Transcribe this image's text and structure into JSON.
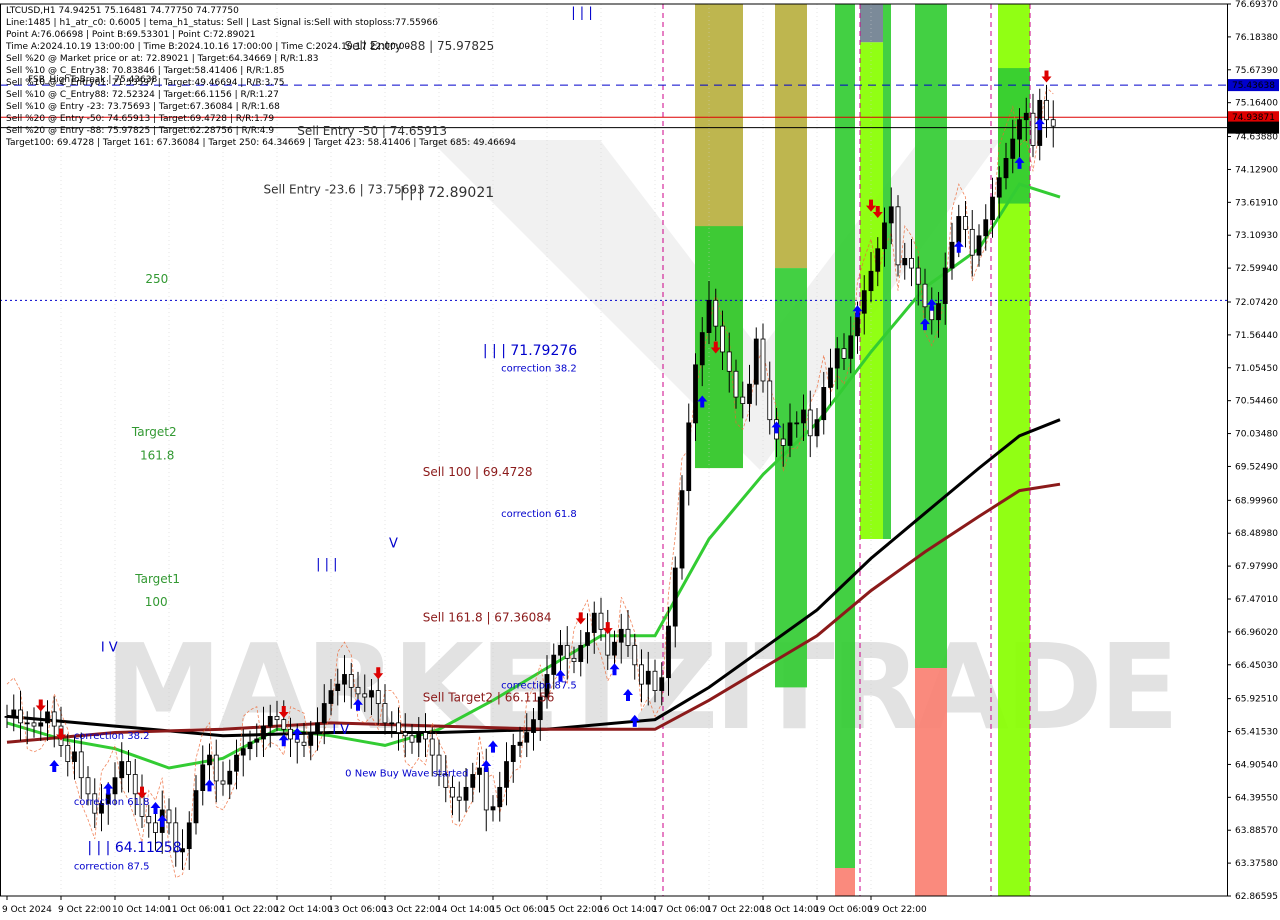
{
  "header": {
    "lines": [
      "LTCUSD,H1  74.94251 75.16481 74.77750 74.77750",
      "Line:1485  | h1_atr_c0: 0.6005  | tema_h1_status: Sell  | Last Signal is:Sell with stoploss:77.55966",
      "Point A:76.06698  | Point B:69.53301  | Point C:72.89021",
      "Time A:2024.10.19 13:00:00  | Time B:2024.10.16 17:00:00  | Time C:2024.10.17 22:00:00",
      "Sell %20 @ Market price or at: 72.89021  | Target:64.34669  | R/R:1.83",
      "Sell %10 @ C_Entry38: 70.83846  | Target:58.41406  | R/R:1.85",
      "Sell %10 @ C_Entry61: 71.53597  | Target:49.46694  | R/R:3.75",
      "Sell %10 @ C_Entry88: 72.52324  | Target:66.1156  | R/R:1.27",
      "Sell %10 @ Entry -23: 73.75693  | Target:67.36084  | R/R:1.68",
      "Sell %20 @ Entry -50: 74.65913  | Target:69.4728  | R/R:1.79",
      "Sell %20 @ Entry -88: 75.97825  | Target:62.28756  | R/R:4.9",
      "Target100: 69.4728  | Target 161: 67.36084  | Target 250: 64.34669  | Target 423: 58.41406  | Target 685: 49.46694"
    ],
    "overlay_label": "FSB_HighToBreak | 75.43638"
  },
  "colors": {
    "background": "#ffffff",
    "bull_candle": "#000000",
    "green_ma": "#33cc33",
    "black_ma": "#000000",
    "red_ma": "#8b1a1a",
    "buy_arrow": "#0000ff",
    "sell_arrow": "#dd0000",
    "zone_green": "#33cc33",
    "zone_lime": "#88ff00",
    "zone_olive": "#b8b040",
    "zone_salmon": "#fa8072",
    "zone_slate": "#708090",
    "price_line_red": "#dd0000",
    "price_line_blue": "#0000cc",
    "vline_magenta": "#cc0088",
    "ann_green": "#339933",
    "ann_blue": "#0000cc",
    "ann_darkred": "#8b1a1a",
    "ann_darkgray": "#333333",
    "watermark": "#dddddd"
  },
  "watermark": {
    "text": "MARKETZITRADE"
  },
  "price_tags": [
    {
      "label": "75.43638",
      "value": 75.43638,
      "bg": "#0000cc",
      "fg": "#ffffff",
      "style": "dashed"
    },
    {
      "label": "74.93871",
      "value": 74.93871,
      "bg": "#dd0000",
      "fg": "#ffffff",
      "style": "solid"
    },
    {
      "label": "74.77750",
      "value": 74.7775,
      "bg": "#000000",
      "fg": "#ffffff",
      "style": "solid"
    }
  ],
  "hlines": [
    {
      "value": 72.1,
      "color": "#0000cc",
      "style": "dotted"
    }
  ],
  "annotations": [
    {
      "text": "Sell Entry -88 | 75.97825",
      "color": "#333333",
      "size": 12,
      "x": 50,
      "y": 75.97825
    },
    {
      "text": "Sell Entry -50 | 74.65913",
      "color": "#333333",
      "size": 12,
      "x": 43,
      "y": 74.65913
    },
    {
      "text": "Sell Entry -23.6 | 73.75693",
      "color": "#333333",
      "size": 12,
      "x": 38,
      "y": 73.75693
    },
    {
      "text": "| | | 72.89021",
      "color": "#333333",
      "size": 14,
      "x": 58.2,
      "y": 73.7
    },
    {
      "text": "250",
      "color": "#339933",
      "size": 12,
      "x": 20.5,
      "y": 72.37
    },
    {
      "text": "| | | 71.79276",
      "color": "#0000cc",
      "size": 14,
      "x": 70.5,
      "y": 71.25
    },
    {
      "text": "correction 38.2",
      "color": "#0000cc",
      "size": 10,
      "x": 73.2,
      "y": 71.0
    },
    {
      "text": "Target2",
      "color": "#339933",
      "size": 12,
      "x": 18.5,
      "y": 70.0
    },
    {
      "text": "161.8",
      "color": "#339933",
      "size": 12,
      "x": 19.7,
      "y": 69.63
    },
    {
      "text": "Sell 100 | 69.4728",
      "color": "#8b1a1a",
      "size": 12,
      "x": 61.6,
      "y": 69.38
    },
    {
      "text": "correction 61.8",
      "color": "#0000cc",
      "size": 10,
      "x": 73.2,
      "y": 68.74
    },
    {
      "text": "| | |",
      "color": "#0000cc",
      "size": 13,
      "x": 45.8,
      "y": 67.95
    },
    {
      "text": "V",
      "color": "#0000cc",
      "size": 13,
      "x": 56.6,
      "y": 68.27
    },
    {
      "text": "Target1",
      "color": "#339933",
      "size": 12,
      "x": 19.0,
      "y": 67.72
    },
    {
      "text": "100",
      "color": "#339933",
      "size": 12,
      "x": 20.4,
      "y": 67.36
    },
    {
      "text": "Sell 161.8 | 67.36084",
      "color": "#8b1a1a",
      "size": 12,
      "x": 61.6,
      "y": 67.12
    },
    {
      "text": "I V",
      "color": "#0000cc",
      "size": 13,
      "x": 13.9,
      "y": 66.66
    },
    {
      "text": "correction 87.5",
      "color": "#0000cc",
      "size": 10,
      "x": 73.2,
      "y": 66.08
    },
    {
      "text": "Sell Target2 | 66.1156",
      "color": "#8b1a1a",
      "size": 12,
      "x": 61.6,
      "y": 65.88
    },
    {
      "text": "correction 38.2",
      "color": "#0000cc",
      "size": 10,
      "x": 9.9,
      "y": 65.3
    },
    {
      "text": "I V",
      "color": "#0000cc",
      "size": 13,
      "x": 48.2,
      "y": 65.38
    },
    {
      "text": "0 New Buy Wave started",
      "color": "#0000cc",
      "size": 10,
      "x": 50.1,
      "y": 64.72
    },
    {
      "text": "correction 61.8",
      "color": "#0000cc",
      "size": 10,
      "x": 9.9,
      "y": 64.28
    },
    {
      "text": "| | | 64.11258",
      "color": "#0000cc",
      "size": 14,
      "x": 11.9,
      "y": 63.55
    },
    {
      "text": "correction 87.5",
      "color": "#0000cc",
      "size": 10,
      "x": 9.9,
      "y": 63.28
    },
    {
      "text": "| | |",
      "color": "#0000cc",
      "size": 13,
      "x": 83.6,
      "y": 76.5
    }
  ],
  "chart_data": {
    "type": "candlestick",
    "symbol": "LTCUSD",
    "timeframe": "H1",
    "ohlc_last": {
      "open": 74.94251,
      "high": 75.16481,
      "low": 74.7775,
      "close": 74.7775
    },
    "ylim": [
      62.86595,
      76.6937
    ],
    "yticks": [
      76.6937,
      76.1838,
      75.6739,
      75.164,
      74.6388,
      74.129,
      73.6191,
      73.1093,
      72.5994,
      72.0742,
      71.5644,
      71.0545,
      70.5446,
      70.0348,
      69.5249,
      68.9996,
      68.4898,
      67.9799,
      67.4701,
      66.9602,
      66.4503,
      65.9251,
      65.4153,
      64.9054,
      64.3955,
      63.8857,
      63.3758,
      62.86595
    ],
    "ytick_labels": [
      "76.69370",
      "76.18380",
      "75.67390",
      "75.16400",
      "74.63880",
      "74.12900",
      "73.61910",
      "73.10930",
      "72.59940",
      "72.07420",
      "71.56440",
      "71.05450",
      "70.54460",
      "70.03480",
      "69.52490",
      "68.99960",
      "68.48980",
      "67.97990",
      "67.47010",
      "66.96020",
      "66.45030",
      "65.92510",
      "65.41530",
      "64.90540",
      "64.39550",
      "63.88570",
      "63.37580",
      "62.86595"
    ],
    "xticks": [
      0,
      8,
      16,
      24,
      32,
      40,
      48,
      56,
      64,
      72,
      80,
      88,
      96,
      104,
      112,
      120,
      128
    ],
    "xtick_labels": [
      "9 Oct 2024",
      "9 Oct 22:00",
      "10 Oct 14:00",
      "11 Oct 06:00",
      "11 Oct 22:00",
      "12 Oct 14:00",
      "13 Oct 06:00",
      "13 Oct 22:00",
      "14 Oct 14:00",
      "15 Oct 06:00",
      "15 Oct 22:00",
      "16 Oct 14:00",
      "17 Oct 06:00",
      "17 Oct 22:00",
      "18 Oct 14:00",
      "19 Oct 06:00",
      "19 Oct 22:00"
    ],
    "x_count": 156,
    "closes": [
      65.65,
      65.75,
      65.55,
      65.55,
      65.5,
      65.55,
      65.72,
      65.5,
      65.2,
      64.95,
      65.1,
      64.7,
      64.45,
      64.15,
      64.3,
      64.45,
      64.7,
      64.95,
      64.75,
      64.45,
      64.1,
      64.0,
      63.85,
      64.2,
      64.0,
      63.55,
      63.6,
      64.0,
      64.5,
      64.9,
      65.05,
      64.65,
      64.6,
      64.8,
      65.05,
      65.15,
      65.25,
      65.3,
      65.5,
      65.65,
      65.6,
      65.45,
      65.3,
      65.25,
      65.2,
      65.4,
      65.55,
      65.85,
      66.05,
      66.15,
      66.3,
      66.1,
      66.0,
      65.95,
      66.05,
      65.85,
      65.55,
      65.55,
      65.4,
      65.35,
      65.25,
      65.4,
      65.3,
      65.05,
      64.75,
      64.55,
      64.4,
      64.35,
      64.55,
      64.75,
      64.85,
      64.2,
      64.25,
      64.55,
      64.95,
      65.2,
      65.25,
      65.4,
      65.6,
      65.95,
      66.3,
      66.6,
      66.75,
      66.55,
      66.5,
      66.75,
      66.95,
      67.25,
      67.0,
      66.6,
      66.8,
      67.0,
      66.75,
      66.45,
      66.15,
      66.35,
      66.05,
      66.25,
      67.05,
      67.95,
      69.15,
      70.2,
      71.1,
      71.6,
      72.1,
      71.7,
      71.3,
      71.0,
      70.6,
      70.5,
      70.8,
      71.5,
      70.85,
      70.25,
      69.95,
      69.85,
      70.2,
      70.2,
      70.4,
      70.0,
      70.25,
      70.75,
      71.05,
      71.35,
      71.2,
      71.55,
      71.9,
      72.25,
      72.55,
      72.9,
      73.3,
      73.55,
      72.65,
      72.75,
      72.6,
      72.35,
      72.0,
      71.8,
      72.05,
      72.6,
      73.0,
      73.4,
      73.2,
      72.8,
      73.1,
      73.35,
      73.7,
      74.0,
      74.3,
      74.6,
      74.9,
      75.0,
      74.5,
      75.2,
      74.9,
      74.8
    ],
    "series": [
      {
        "name": "",
        "color": "#33cc33",
        "points": [
          [
            0,
            65.55
          ],
          [
            8,
            65.3
          ],
          [
            16,
            65.15
          ],
          [
            24,
            64.85
          ],
          [
            32,
            65.0
          ],
          [
            40,
            65.45
          ],
          [
            48,
            65.35
          ],
          [
            56,
            65.2
          ],
          [
            64,
            65.45
          ],
          [
            72,
            65.9
          ],
          [
            80,
            66.4
          ],
          [
            88,
            66.9
          ],
          [
            96,
            66.9
          ],
          [
            104,
            68.4
          ],
          [
            112,
            69.4
          ],
          [
            120,
            70.2
          ],
          [
            128,
            71.3
          ],
          [
            136,
            72.3
          ],
          [
            144,
            72.9
          ],
          [
            150,
            73.9
          ],
          [
            156,
            73.7
          ]
        ]
      },
      {
        "name": "",
        "color": "#000000",
        "points": [
          [
            0,
            65.65
          ],
          [
            16,
            65.5
          ],
          [
            32,
            65.35
          ],
          [
            48,
            65.4
          ],
          [
            64,
            65.4
          ],
          [
            80,
            65.45
          ],
          [
            96,
            65.6
          ],
          [
            104,
            66.1
          ],
          [
            112,
            66.7
          ],
          [
            120,
            67.3
          ],
          [
            128,
            68.1
          ],
          [
            136,
            68.8
          ],
          [
            144,
            69.5
          ],
          [
            150,
            70.0
          ],
          [
            156,
            70.25
          ]
        ]
      },
      {
        "name": "",
        "color": "#8b1a1a",
        "points": [
          [
            0,
            65.25
          ],
          [
            16,
            65.4
          ],
          [
            32,
            65.45
          ],
          [
            48,
            65.55
          ],
          [
            64,
            65.5
          ],
          [
            80,
            65.45
          ],
          [
            96,
            65.45
          ],
          [
            104,
            65.9
          ],
          [
            112,
            66.4
          ],
          [
            120,
            66.9
          ],
          [
            128,
            67.6
          ],
          [
            136,
            68.2
          ],
          [
            144,
            68.75
          ],
          [
            150,
            69.15
          ],
          [
            156,
            69.25
          ]
        ]
      }
    ]
  }
}
